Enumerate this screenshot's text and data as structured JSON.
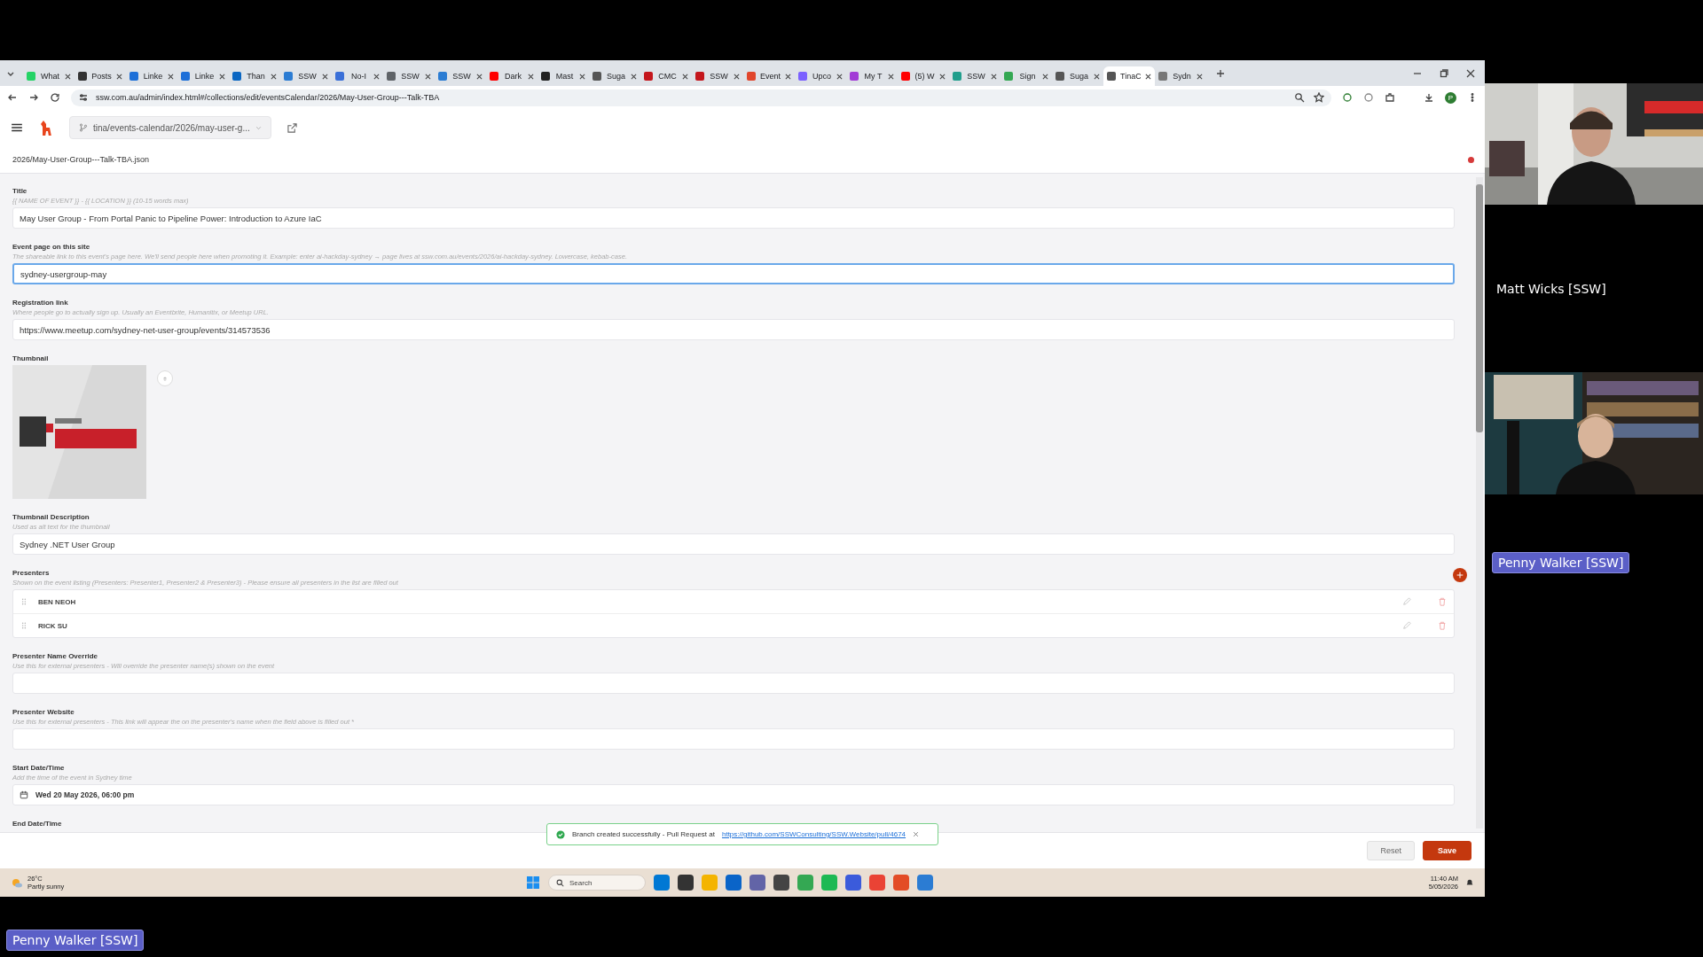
{
  "browser": {
    "tabs": [
      {
        "label": "What",
        "color": "#25d366",
        "selected": false
      },
      {
        "label": "Posts",
        "color": "#333333",
        "selected": false
      },
      {
        "label": "Linke",
        "color": "#1d6fd8",
        "selected": false
      },
      {
        "label": "Linke",
        "color": "#1d6fd8",
        "selected": false
      },
      {
        "label": "Than",
        "color": "#0a66c2",
        "selected": false
      },
      {
        "label": "SSW",
        "color": "#2b7cd3",
        "selected": false
      },
      {
        "label": "No-I",
        "color": "#3a6fd8",
        "selected": false
      },
      {
        "label": "SSW",
        "color": "#5f6368",
        "selected": false
      },
      {
        "label": "SSW",
        "color": "#2b7cd3",
        "selected": false
      },
      {
        "label": "Dark",
        "color": "#ff0000",
        "selected": false
      },
      {
        "label": "Mast",
        "color": "#222222",
        "selected": false
      },
      {
        "label": "Suga",
        "color": "#555555",
        "selected": false
      },
      {
        "label": "CMC",
        "color": "#c4161c",
        "selected": false
      },
      {
        "label": "SSW",
        "color": "#c4161c",
        "selected": false
      },
      {
        "label": "Event",
        "color": "#e1462c",
        "selected": false
      },
      {
        "label": "Upco",
        "color": "#7b61ff",
        "selected": false
      },
      {
        "label": "My T",
        "color": "#a23bd6",
        "selected": false
      },
      {
        "label": "(5) W",
        "color": "#ff0000",
        "selected": false
      },
      {
        "label": "SSW",
        "color": "#1f9e8c",
        "selected": false
      },
      {
        "label": "Sign",
        "color": "#34a853",
        "selected": false
      },
      {
        "label": "Suga",
        "color": "#555555",
        "selected": false
      },
      {
        "label": "TinaC",
        "color": "#555555",
        "selected": true
      },
      {
        "label": "Sydn",
        "color": "#777777",
        "selected": false
      }
    ],
    "address": "ssw.com.au/admin/index.html#/collections/edit/eventsCalendar/2026/May-User-Group---Talk-TBA",
    "profile_initial": "P"
  },
  "cms": {
    "branch": "tina/events-calendar/2026/may-user-g...",
    "file": "2026/May-User-Group---Talk-TBA.json",
    "unsaved": true,
    "fields": [
      {
        "kind": "text",
        "label": "Title",
        "hint": "{{ NAME OF EVENT }} - {{ LOCATION }} (10-15 words max)",
        "value": "May User Group - From Portal Panic to Pipeline Power: Introduction to Azure IaC",
        "focused": false
      },
      {
        "kind": "text",
        "label": "Event page on this site",
        "hint": "The shareable link to this event's page here. We'll send people here when promoting it. Example: enter ai-hackday-sydney → page lives at ssw.com.au/events/2026/ai-hackday-sydney. Lowercase, kebab-case.",
        "value": "sydney-usergroup-may",
        "focused": true
      },
      {
        "kind": "text",
        "label": "Registration link",
        "hint": "Where people go to actually sign up. Usually an Eventbrite, Humanitix, or Meetup URL.",
        "value": "https://www.meetup.com/sydney-net-user-group/events/314573536",
        "focused": false
      },
      {
        "label": "Thumbnail"
      },
      {
        "kind": "text",
        "label": "Thumbnail Description",
        "hint": "Used as alt text for the thumbnail",
        "value": "Sydney .NET User Group",
        "focused": false
      },
      {
        "kind": "list",
        "label": "Presenters",
        "hint": "Shown on the event listing (Presenters: Presenter1, Presenter2 & Presenter3) - Please ensure all presenters in the list are filled out",
        "items": [
          "BEN NEOH",
          "RICK SU"
        ]
      },
      {
        "kind": "text",
        "label": "Presenter Name Override",
        "hint": "Use this for external presenters - Will override the presenter name(s) shown on the event",
        "focused": false
      },
      {
        "kind": "text",
        "label": "Presenter Website",
        "hint": "Use this for external presenters - This link will appear the on the presenter's name when the field above is filled out *",
        "focused": false
      },
      {
        "kind": "date",
        "label": "Start Date/Time",
        "hint": "Add the time of the event in Sydney time",
        "value": "Wed 20 May 2026, 06:00 pm"
      },
      {
        "kind": "heading",
        "label": "End Date/Time"
      }
    ],
    "toast": {
      "message": "Branch created successfully - Pull Request at",
      "link": "https://github.com/SSWConsulting/SSW.Website/pull/4674"
    },
    "actions": [
      {
        "label": "Reset",
        "kind": "secondary"
      },
      {
        "label": "Save",
        "kind": "primary"
      }
    ]
  },
  "taskbar": {
    "temperature": "26°C",
    "weather": "Partly sunny",
    "search": "Search",
    "time": "11:40 AM",
    "date": "5/05/2026"
  },
  "call": {
    "tiles": [
      {
        "kind": "video"
      },
      {
        "kind": "name",
        "name": "Matt Wicks [SSW]"
      },
      {
        "kind": "video"
      },
      {
        "kind": "badge",
        "name": "Penny Walker [SSW]"
      }
    ],
    "presenter_badge": "Penny Walker [SSW]"
  }
}
